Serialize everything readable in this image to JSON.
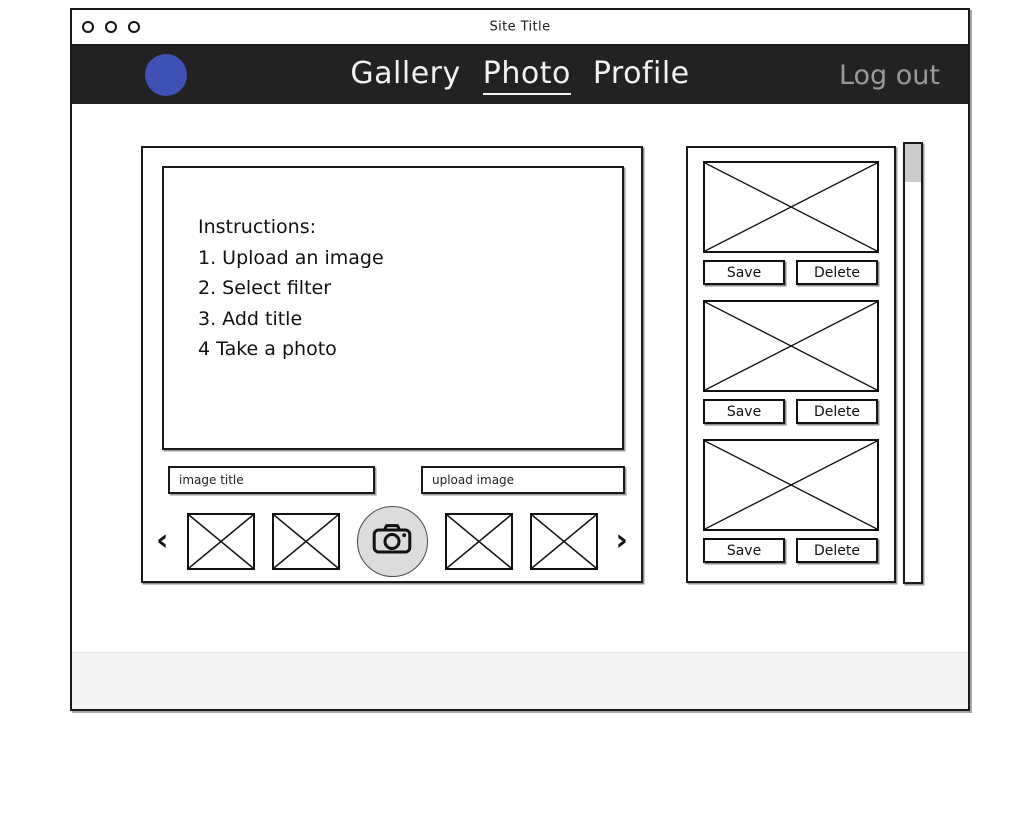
{
  "window": {
    "site_title": "Site Title",
    "traffic_lights": [
      "close-dot",
      "minimize-dot",
      "maximize-dot"
    ]
  },
  "navbar": {
    "avatar_color": "#3f51b5",
    "background_color": "#222222",
    "links": [
      {
        "label": "Gallery",
        "active": false
      },
      {
        "label": "Photo",
        "active": true
      },
      {
        "label": "Profile",
        "active": false
      }
    ],
    "logout_label": "Log out"
  },
  "editor": {
    "instructions": [
      "Instructions:",
      "1. Upload an image",
      "2. Select filter",
      "3. Add title",
      "4 Take a photo"
    ],
    "title_field": {
      "value": "image title",
      "placeholder": "image title"
    },
    "upload_field": {
      "value": "upload image",
      "placeholder": "upload image"
    },
    "carousel": {
      "prev_label": "‹",
      "next_label": "›",
      "thumbnails": [
        "filter-thumbnail-1",
        "filter-thumbnail-2",
        "filter-thumbnail-3",
        "filter-thumbnail-4"
      ],
      "camera_button_label": "camera-icon"
    }
  },
  "gallery": {
    "items": [
      {
        "image": "gallery-image-placeholder",
        "save_label": "Save",
        "delete_label": "Delete"
      },
      {
        "image": "gallery-image-placeholder",
        "save_label": "Save",
        "delete_label": "Delete"
      },
      {
        "image": "gallery-image-placeholder",
        "save_label": "Save",
        "delete_label": "Delete"
      }
    ],
    "scrollbar": {
      "thumb_position": "top",
      "thumb_color": "#cccccc"
    }
  }
}
